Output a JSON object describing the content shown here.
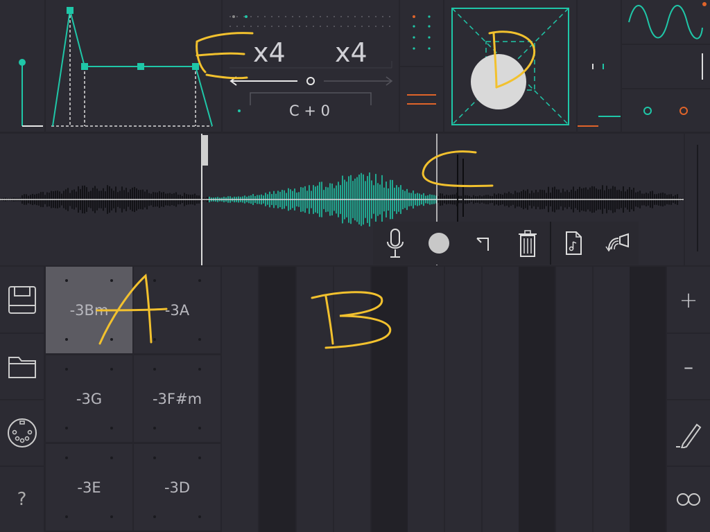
{
  "envelope": {
    "attack": "attack-node",
    "sustain": "sustain-node"
  },
  "pitch": {
    "multiplier_left": "x4",
    "multiplier_right": "x4",
    "transpose": "C + 0"
  },
  "sampler": {
    "mic_icon": "microphone-icon",
    "record_icon": "record-icon",
    "trim_icon": "trim-icon",
    "delete_icon": "trash-icon",
    "file_icon": "music-file-icon",
    "share_icon": "share-icon"
  },
  "pads": [
    {
      "label": "-3Bm",
      "active": true
    },
    {
      "label": "-3A",
      "active": false
    },
    {
      "label": "-3G",
      "active": false
    },
    {
      "label": "-3F#m",
      "active": false
    },
    {
      "label": "-3E",
      "active": false
    },
    {
      "label": "-3D",
      "active": false
    }
  ],
  "sidebar": {
    "items": [
      {
        "icon": "save-icon"
      },
      {
        "icon": "folder-icon"
      },
      {
        "icon": "midi-icon"
      },
      {
        "icon": "help-icon",
        "label": "?"
      }
    ]
  },
  "rightbar": {
    "items": [
      {
        "icon": "plus-icon",
        "label": "+"
      },
      {
        "icon": "minus-icon",
        "label": "–"
      },
      {
        "icon": "pencil-icon"
      },
      {
        "icon": "loop-icon"
      }
    ]
  },
  "annotations": {
    "a": "A",
    "b": "B",
    "c": "C",
    "d": "D",
    "e": "E"
  },
  "colors": {
    "accent_teal": "#1fc7a8",
    "accent_orange": "#e0642a",
    "annotation_yellow": "#f2c12e",
    "background": "#26252c"
  }
}
